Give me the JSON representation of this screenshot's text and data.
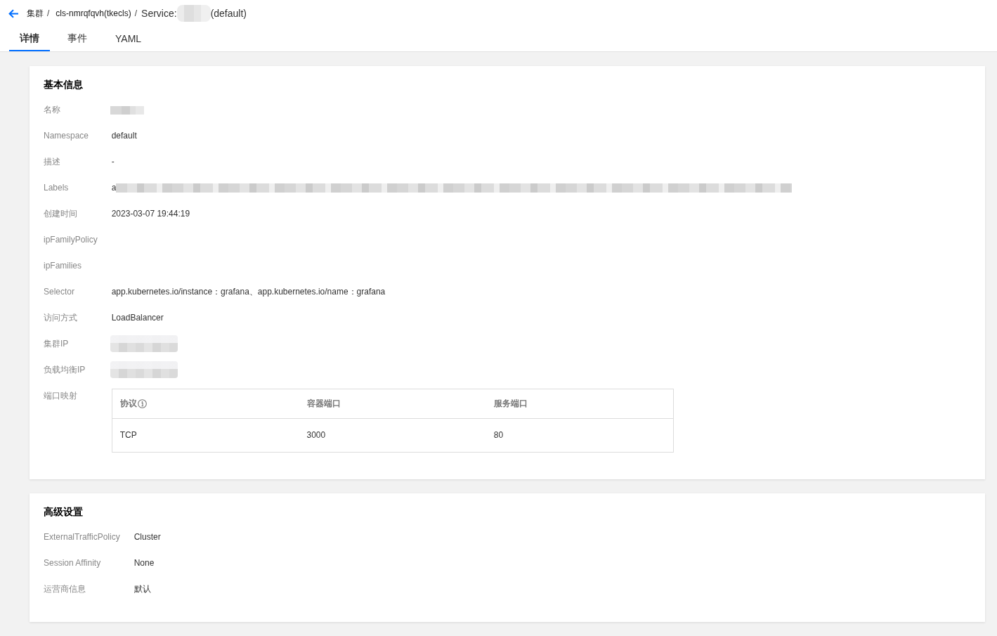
{
  "breadcrumb": {
    "items": [
      "集群",
      "cls-nmrqfqvh(tkecls)"
    ],
    "separator": "/",
    "current": {
      "prefix": "Service:",
      "masked": true,
      "suffix": "(default)"
    }
  },
  "tabs": [
    {
      "label": "详情",
      "selected": true
    },
    {
      "label": "事件",
      "selected": false
    },
    {
      "label": "YAML",
      "selected": false
    }
  ],
  "sections": [
    {
      "title": "基本信息",
      "rows": [
        {
          "label": "名称",
          "kind": "redacted"
        },
        {
          "label": "Namespace",
          "kind": "text",
          "value": "default"
        },
        {
          "label": "描述",
          "kind": "text",
          "value": "-"
        },
        {
          "label": "Labels",
          "kind": "redactedline",
          "value": "a"
        },
        {
          "label": "创建时间",
          "kind": "text",
          "value": "2023-03-07 19:44:19"
        },
        {
          "label": "ipFamilyPolicy",
          "kind": "blank"
        },
        {
          "label": "ipFamilies",
          "kind": "blank"
        },
        {
          "label": "Selector",
          "kind": "text",
          "value": "app.kubernetes.io/instance：grafana、app.kubernetes.io/name：grafana"
        },
        {
          "label": "访问方式",
          "kind": "text",
          "value": "LoadBalancer"
        },
        {
          "label": "集群IP",
          "kind": "redactedip"
        },
        {
          "label": "负载均衡IP",
          "kind": "redactedip"
        },
        {
          "label": "端口映射",
          "kind": "table",
          "table": {
            "columns": [
              {
                "label": "协议",
                "info": true
              },
              {
                "label": "容器端口",
                "info": false
              },
              {
                "label": "服务端口",
                "info": false
              }
            ],
            "rows": [
              [
                "TCP",
                "3000",
                "80"
              ]
            ]
          }
        }
      ]
    },
    {
      "title": "高级设置",
      "rows": [
        {
          "label": "ExternalTrafficPolicy",
          "kind": "text",
          "value": "Cluster"
        },
        {
          "label": "Session Affinity",
          "kind": "text",
          "value": "None"
        },
        {
          "label": "运营商信息",
          "kind": "text",
          "value": "默认"
        }
      ]
    }
  ]
}
